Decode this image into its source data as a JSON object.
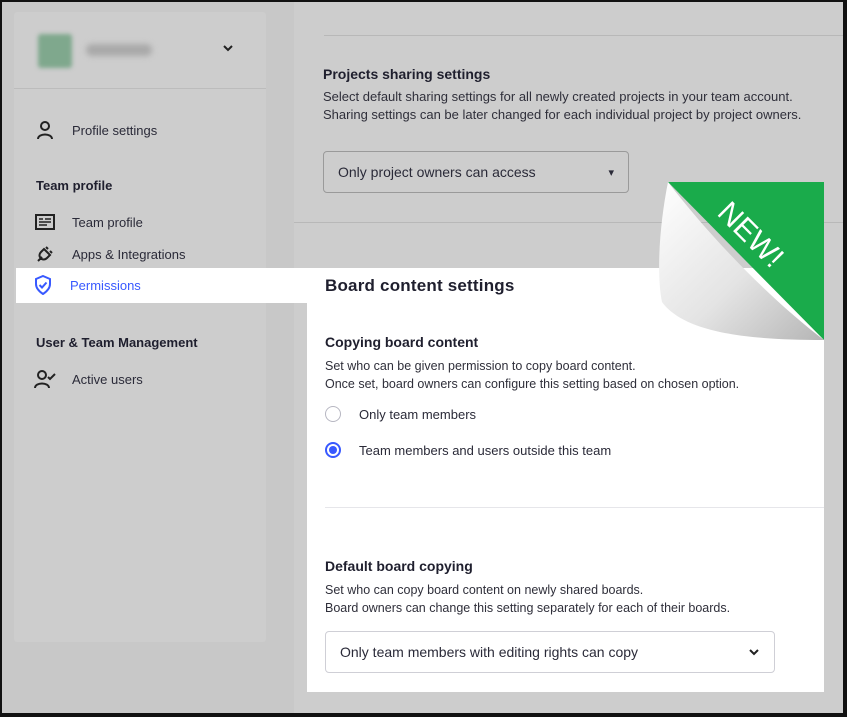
{
  "sidebar": {
    "items": {
      "profile_settings": "Profile settings",
      "team_profile_heading": "Team profile",
      "team_profile": "Team profile",
      "apps": "Apps & Integrations",
      "permissions": "Permissions",
      "user_mgmt_heading": "User & Team Management",
      "active_users": "Active users"
    }
  },
  "projects_sharing": {
    "title": "Projects sharing settings",
    "desc_1": "Select default sharing settings for all newly created projects in your team account.",
    "desc_2": "Sharing settings can be later changed for each individual project by project owners.",
    "select_value": "Only project owners can access"
  },
  "board_content": {
    "title": "Board content settings",
    "copying": {
      "title": "Copying board content",
      "desc_1": "Set who can be given permission to copy board content.",
      "desc_2": "Once set, board owners can configure this setting based on chosen option.",
      "options": [
        "Only team members",
        "Team members and users outside this team"
      ],
      "selected_index": 1
    },
    "default_copying": {
      "title": "Default board copying",
      "desc_1": "Set who can copy board content on newly shared boards.",
      "desc_2": "Board owners can change this setting separately for each of their boards.",
      "select_value": "Only team members with editing rights can copy"
    }
  },
  "badge": {
    "text": "NEW!",
    "color": "#1aab4b"
  },
  "colors": {
    "accent": "#3859ff"
  }
}
